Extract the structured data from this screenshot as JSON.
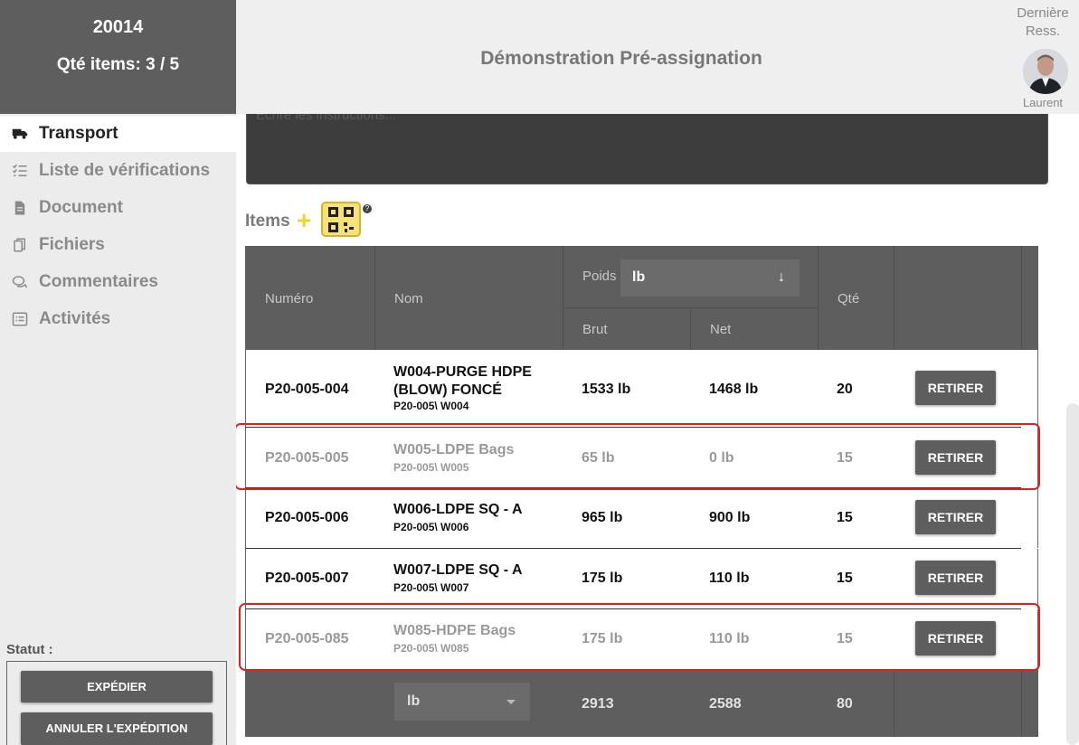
{
  "top_left": {
    "number": "20014",
    "qty": "Qté items: 3 / 5"
  },
  "header": {
    "title": "Démonstration Pré-assignation",
    "last_res": "Dernière Ress.",
    "user": "Laurent"
  },
  "nav": [
    {
      "label": "Transport",
      "icon": "truck-icon",
      "active": true
    },
    {
      "label": "Liste de vérifications",
      "icon": "checklist-icon",
      "active": false
    },
    {
      "label": "Document",
      "icon": "document-icon",
      "active": false
    },
    {
      "label": "Fichiers",
      "icon": "files-icon",
      "active": false
    },
    {
      "label": "Commentaires",
      "icon": "comments-icon",
      "active": false
    },
    {
      "label": "Activités",
      "icon": "activities-icon",
      "active": false
    }
  ],
  "status": {
    "label": "Statut :",
    "ship_btn": "EXPÉDIER",
    "cancel_btn": "ANNULER L'EXPÉDITION"
  },
  "instructions": {
    "placeholder": "Écrire les instructions..."
  },
  "items": {
    "title": "Items",
    "headers": {
      "numero": "Numéro",
      "nom": "Nom",
      "poids": "Poids",
      "unit": "lb",
      "brut": "Brut",
      "net": "Net",
      "qte": "Qté"
    },
    "rows": [
      {
        "numero": "P20-005-004",
        "nom": "W004-PURGE HDPE (BLOW) FONCÉ",
        "code": "P20-005\\ W004",
        "brut": "1533 lb",
        "net": "1468 lb",
        "qte": "20",
        "action": "RETIRER",
        "highlighted": false
      },
      {
        "numero": "P20-005-005",
        "nom": "W005-LDPE Bags",
        "code": "P20-005\\ W005",
        "brut": "65 lb",
        "net": "0 lb",
        "qte": "15",
        "action": "RETIRER",
        "highlighted": true
      },
      {
        "numero": "P20-005-006",
        "nom": "W006-LDPE SQ - A",
        "code": "P20-005\\ W006",
        "brut": "965 lb",
        "net": "900 lb",
        "qte": "15",
        "action": "RETIRER",
        "highlighted": false
      },
      {
        "numero": "P20-005-007",
        "nom": "W007-LDPE SQ - A",
        "code": "P20-005\\ W007",
        "brut": "175 lb",
        "net": "110 lb",
        "qte": "15",
        "action": "RETIRER",
        "highlighted": false
      },
      {
        "numero": "P20-005-085",
        "nom": "W085-HDPE Bags",
        "code": "P20-005\\ W085",
        "brut": "175 lb",
        "net": "110 lb",
        "qte": "15",
        "action": "RETIRER",
        "highlighted": true
      }
    ],
    "totals": {
      "unit": "lb",
      "brut": "2913",
      "net": "2588",
      "qte": "80"
    }
  },
  "colors": {
    "dark": "#5e5e5e",
    "accent": "#f4d32b",
    "highlight": "#e31e1e"
  }
}
